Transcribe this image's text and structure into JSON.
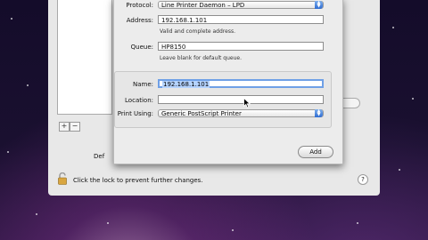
{
  "sheet": {
    "protocol": {
      "label": "Protocol:",
      "value": "Line Printer Daemon – LPD"
    },
    "address": {
      "label": "Address:",
      "value": "192.168.1.101",
      "hint": "Valid and complete address."
    },
    "queue": {
      "label": "Queue:",
      "value": "HP8150",
      "hint": "Leave blank for default queue."
    },
    "name": {
      "label": "Name:",
      "value": "192.168.1.101"
    },
    "location": {
      "label": "Location:",
      "value": ""
    },
    "print_using": {
      "label": "Print Using:",
      "value": "Generic PostScript Printer"
    },
    "add_button": "Add"
  },
  "prefs": {
    "lock_text": "Click the lock to prevent further changes.",
    "partial_label": "Def",
    "help": "?",
    "add_symbol": "+",
    "remove_symbol": "−"
  },
  "colors": {
    "accent": "#2e6bd1",
    "selection": "#b5d3ff"
  },
  "icons": [
    "lock-icon",
    "help-icon",
    "popup-arrows-icon",
    "mouse-cursor-icon"
  ]
}
